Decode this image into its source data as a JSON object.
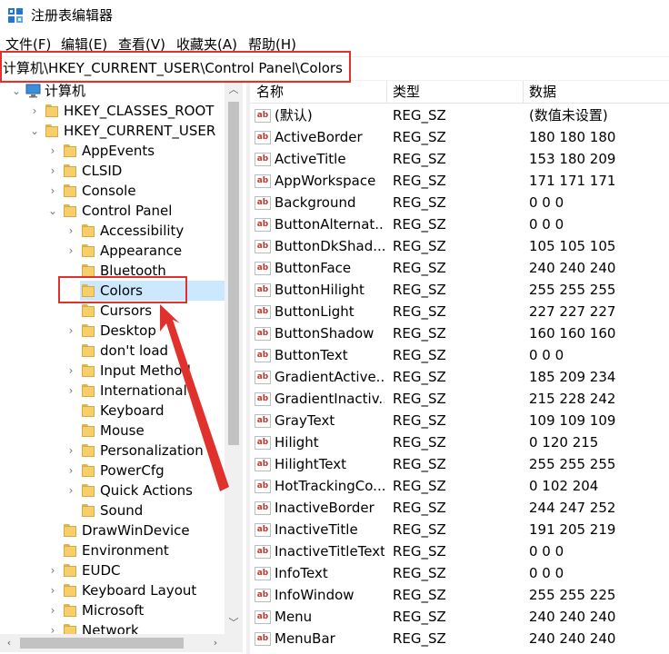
{
  "window": {
    "title": "注册表编辑器"
  },
  "menu": [
    "文件(F)",
    "编辑(E)",
    "查看(V)",
    "收藏夹(A)",
    "帮助(H)"
  ],
  "address": "计算机\\HKEY_CURRENT_USER\\Control Panel\\Colors",
  "tree": {
    "root": "计算机",
    "rows": [
      {
        "label": "HKEY_CLASSES_ROOT",
        "chevron": "›"
      },
      {
        "label": "HKEY_CURRENT_USER",
        "chevron": "⌄"
      },
      {
        "label": "AppEvents",
        "chevron": "›"
      },
      {
        "label": "CLSID",
        "chevron": "›"
      },
      {
        "label": "Console",
        "chevron": "›"
      },
      {
        "label": "Control Panel",
        "chevron": "⌄"
      },
      {
        "label": "Accessibility",
        "chevron": "›"
      },
      {
        "label": "Appearance",
        "chevron": "›"
      },
      {
        "label": "Bluetooth",
        "chevron": ""
      },
      {
        "label": "Colors",
        "chevron": ""
      },
      {
        "label": "Cursors",
        "chevron": ""
      },
      {
        "label": "Desktop",
        "chevron": "›"
      },
      {
        "label": "don't load",
        "chevron": ""
      },
      {
        "label": "Input Method",
        "chevron": "›"
      },
      {
        "label": "International",
        "chevron": "›"
      },
      {
        "label": "Keyboard",
        "chevron": ""
      },
      {
        "label": "Mouse",
        "chevron": ""
      },
      {
        "label": "Personalization",
        "chevron": "›"
      },
      {
        "label": "PowerCfg",
        "chevron": "›"
      },
      {
        "label": "Quick Actions",
        "chevron": "›"
      },
      {
        "label": "Sound",
        "chevron": ""
      },
      {
        "label": "DrawWinDevice",
        "chevron": ""
      },
      {
        "label": "Environment",
        "chevron": ""
      },
      {
        "label": "EUDC",
        "chevron": "›"
      },
      {
        "label": "Keyboard Layout",
        "chevron": "›"
      },
      {
        "label": "Microsoft",
        "chevron": "›"
      },
      {
        "label": "Network",
        "chevron": "›"
      }
    ]
  },
  "list": {
    "headers": {
      "name": "名称",
      "type": "类型",
      "data": "数据"
    },
    "icon_text": "ab",
    "rows": [
      {
        "name": "(默认)",
        "type": "REG_SZ",
        "data": "(数值未设置)"
      },
      {
        "name": "ActiveBorder",
        "type": "REG_SZ",
        "data": "180 180 180"
      },
      {
        "name": "ActiveTitle",
        "type": "REG_SZ",
        "data": "153 180 209"
      },
      {
        "name": "AppWorkspace",
        "type": "REG_SZ",
        "data": "171 171 171"
      },
      {
        "name": "Background",
        "type": "REG_SZ",
        "data": "0 0 0"
      },
      {
        "name": "ButtonAlternat...",
        "type": "REG_SZ",
        "data": "0 0 0"
      },
      {
        "name": "ButtonDkShad...",
        "type": "REG_SZ",
        "data": "105 105 105"
      },
      {
        "name": "ButtonFace",
        "type": "REG_SZ",
        "data": "240 240 240"
      },
      {
        "name": "ButtonHilight",
        "type": "REG_SZ",
        "data": "255 255 255"
      },
      {
        "name": "ButtonLight",
        "type": "REG_SZ",
        "data": "227 227 227"
      },
      {
        "name": "ButtonShadow",
        "type": "REG_SZ",
        "data": "160 160 160"
      },
      {
        "name": "ButtonText",
        "type": "REG_SZ",
        "data": "0 0 0"
      },
      {
        "name": "GradientActive...",
        "type": "REG_SZ",
        "data": "185 209 234"
      },
      {
        "name": "GradientInactiv...",
        "type": "REG_SZ",
        "data": "215 228 242"
      },
      {
        "name": "GrayText",
        "type": "REG_SZ",
        "data": "109 109 109"
      },
      {
        "name": "Hilight",
        "type": "REG_SZ",
        "data": "0 120 215"
      },
      {
        "name": "HilightText",
        "type": "REG_SZ",
        "data": "255 255 255"
      },
      {
        "name": "HotTrackingCo...",
        "type": "REG_SZ",
        "data": "0 102 204"
      },
      {
        "name": "InactiveBorder",
        "type": "REG_SZ",
        "data": "244 247 252"
      },
      {
        "name": "InactiveTitle",
        "type": "REG_SZ",
        "data": "191 205 219"
      },
      {
        "name": "InactiveTitleText",
        "type": "REG_SZ",
        "data": "0 0 0"
      },
      {
        "name": "InfoText",
        "type": "REG_SZ",
        "data": "0 0 0"
      },
      {
        "name": "InfoWindow",
        "type": "REG_SZ",
        "data": "255 255 225"
      },
      {
        "name": "Menu",
        "type": "REG_SZ",
        "data": "240 240 240"
      },
      {
        "name": "MenuBar",
        "type": "REG_SZ",
        "data": "240 240 240"
      }
    ]
  },
  "colors": {
    "annotation": "#e0312c",
    "selection": "#cce8ff"
  }
}
